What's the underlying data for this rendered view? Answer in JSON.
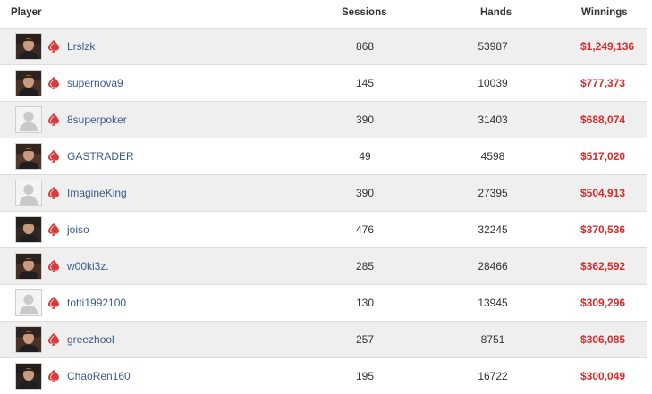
{
  "header": {
    "player": "Player",
    "sessions": "Sessions",
    "hands": "Hands",
    "winnings": "Winnings"
  },
  "colors": {
    "winnings": "#d62b2b",
    "player_link": "#3a5a8a",
    "spade_icon": "#d63c3c",
    "row_alt": "#efefef"
  },
  "rows": [
    {
      "name": "Lrslzk",
      "sessions": "868",
      "hands": "53987",
      "winnings": "$1,249,136",
      "avatar": "photo"
    },
    {
      "name": "supernova9",
      "sessions": "145",
      "hands": "10039",
      "winnings": "$777,373",
      "avatar": "photo"
    },
    {
      "name": "8superpoker",
      "sessions": "390",
      "hands": "31403",
      "winnings": "$688,074",
      "avatar": "placeholder"
    },
    {
      "name": "GASTRADER",
      "sessions": "49",
      "hands": "4598",
      "winnings": "$517,020",
      "avatar": "photo"
    },
    {
      "name": "ImagineKing",
      "sessions": "390",
      "hands": "27395",
      "winnings": "$504,913",
      "avatar": "placeholder"
    },
    {
      "name": "joiso",
      "sessions": "476",
      "hands": "32245",
      "winnings": "$370,536",
      "avatar": "photo"
    },
    {
      "name": "w00ki3z.",
      "sessions": "285",
      "hands": "28466",
      "winnings": "$362,592",
      "avatar": "photo"
    },
    {
      "name": "totti1992100",
      "sessions": "130",
      "hands": "13945",
      "winnings": "$309,296",
      "avatar": "placeholder"
    },
    {
      "name": "greezhool",
      "sessions": "257",
      "hands": "8751",
      "winnings": "$306,085",
      "avatar": "photo"
    },
    {
      "name": "ChaoRen160",
      "sessions": "195",
      "hands": "16722",
      "winnings": "$300,049",
      "avatar": "photo"
    }
  ]
}
